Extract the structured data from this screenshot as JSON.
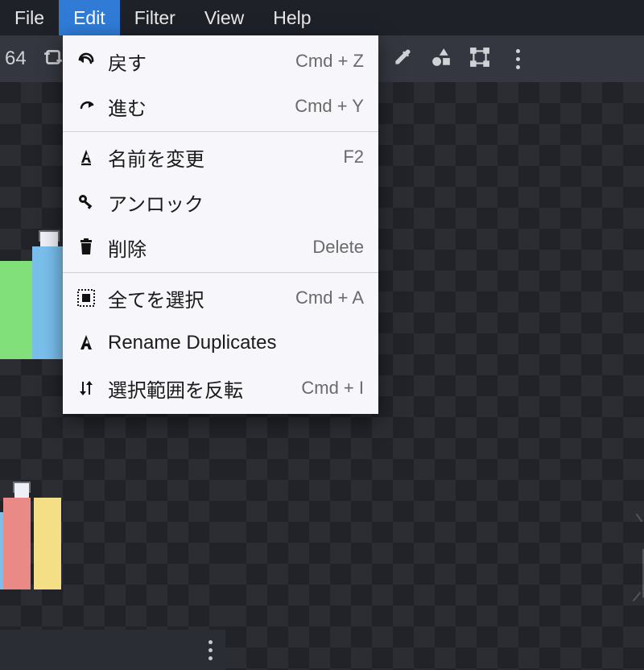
{
  "menubar": {
    "items": [
      {
        "label": "File"
      },
      {
        "label": "Edit"
      },
      {
        "label": "Filter"
      },
      {
        "label": "View"
      },
      {
        "label": "Help"
      }
    ],
    "active_index": 1
  },
  "toolbar": {
    "size_value": "64"
  },
  "edit_menu": {
    "items": [
      {
        "icon": "undo",
        "label": "戻す",
        "shortcut": "Cmd + Z"
      },
      {
        "icon": "redo",
        "label": "進む",
        "shortcut": "Cmd + Y"
      },
      {
        "sep": true
      },
      {
        "icon": "rename",
        "label": "名前を変更",
        "shortcut": "F2"
      },
      {
        "icon": "key",
        "label": "アンロック",
        "shortcut": ""
      },
      {
        "icon": "trash",
        "label": "削除",
        "shortcut": "Delete"
      },
      {
        "sep": true
      },
      {
        "icon": "select-all",
        "label": "全てを選択",
        "shortcut": "Cmd + A"
      },
      {
        "icon": "rename-dup",
        "label": "Rename Duplicates",
        "shortcut": ""
      },
      {
        "icon": "invert",
        "label": "選択範囲を反転",
        "shortcut": "Cmd + I"
      }
    ]
  }
}
